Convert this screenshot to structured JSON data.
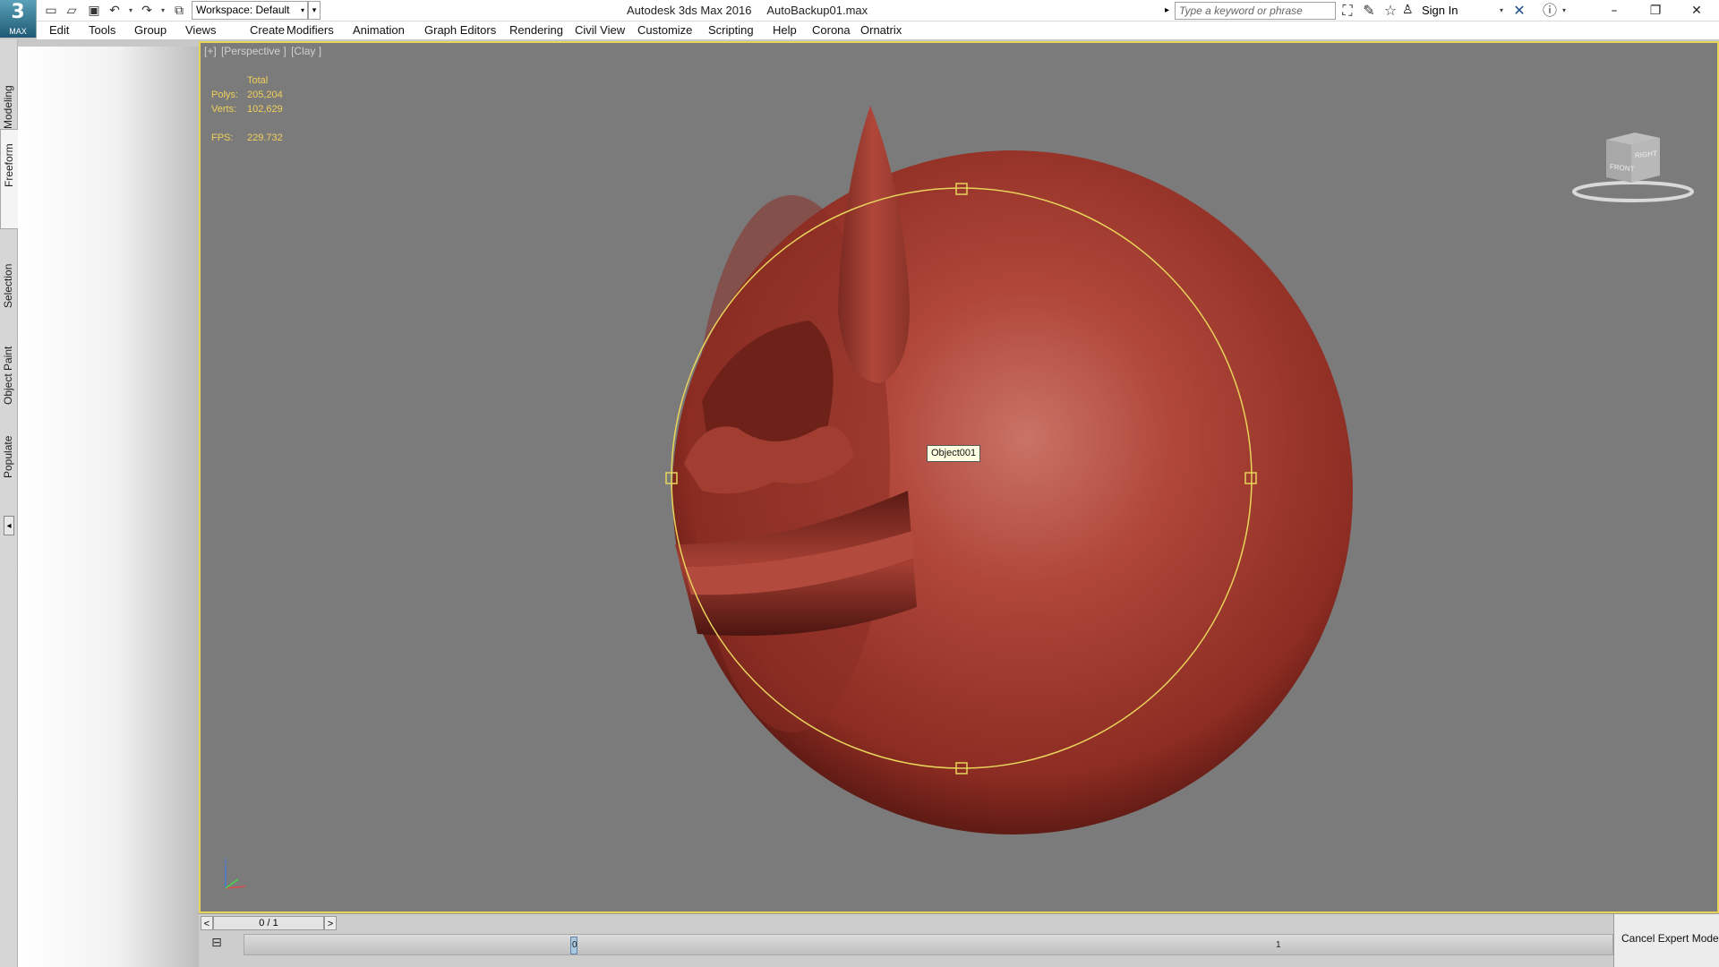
{
  "app": {
    "button_label": "MAX",
    "logo_glyph": "3",
    "title_product": "Autodesk 3ds Max 2016",
    "title_file": "AutoBackup01.max"
  },
  "quick_access": {
    "workspace_label": "Workspace: Default",
    "icons": [
      "new-file-icon",
      "open-file-icon",
      "save-icon",
      "undo-icon",
      "redo-icon",
      "project-folder-icon"
    ]
  },
  "search": {
    "placeholder": "Type a keyword or phrase"
  },
  "account": {
    "sign_in": "Sign In"
  },
  "menu": [
    "Edit",
    "Tools",
    "Group",
    "Views",
    "Create",
    "Modifiers",
    "Animation",
    "Graph Editors",
    "Rendering",
    "Civil View",
    "Customize",
    "Scripting",
    "Help",
    "Corona",
    "Ornatrix"
  ],
  "left_tabs": {
    "modeling": "Modeling",
    "freeform": "Freeform",
    "selection": "Selection",
    "object_paint": "Object Paint",
    "populate": "Populate",
    "active": "Freeform"
  },
  "viewport": {
    "menu_plus": "[+]",
    "view": "[Perspective ]",
    "shading": "[Clay ]",
    "stats_header": "Total",
    "polys_label": "Polys:",
    "polys_value": "205,204",
    "verts_label": "Verts:",
    "verts_value": "102,629",
    "fps_label": "FPS:",
    "fps_value": "229.732",
    "selected_object": "Object001",
    "viewcube_front": "FRONT",
    "viewcube_right": "RIGHT",
    "axis_z": "z"
  },
  "timeline": {
    "prev": "<",
    "next": ">",
    "frame_display": "0 / 1",
    "tick_start": "0",
    "tick_end": "1"
  },
  "status": {
    "cancel_expert_mode": "Cancel Expert Mode"
  },
  "colors": {
    "viewport_bg": "#7b7b7b",
    "selection_yellow": "#e8d45b",
    "stats_text": "#f0d05a",
    "model_red": "#b2463a"
  }
}
